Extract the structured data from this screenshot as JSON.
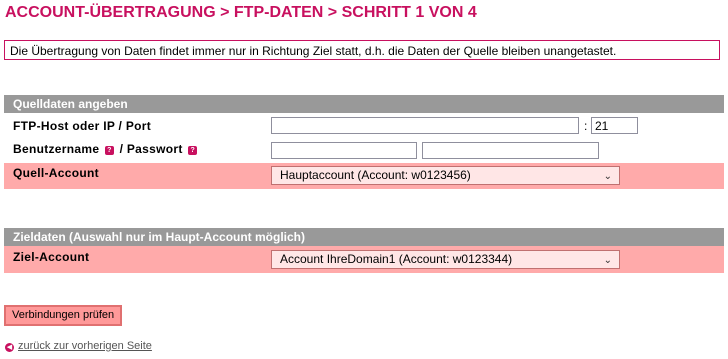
{
  "page": {
    "title": "ACCOUNT-ÜBERTRAGUNG > FTP-DATEN > SCHRITT 1 VON 4",
    "notice": "Die Übertragung von Daten findet immer nur in Richtung Ziel statt, d.h. die Daten der Quelle bleiben unangetastet."
  },
  "source": {
    "header": "Quelldaten angeben",
    "host_label": "FTP-Host oder IP / Port",
    "host_value": "",
    "port_separator": ":",
    "port_value": "21",
    "user_label": "Benutzername",
    "pass_label": "Passwort",
    "label_separator": "/",
    "info_glyph": "?",
    "user_value": "",
    "pass_value": "",
    "account_label": "Quell-Account",
    "account_selected": "Hauptaccount   (Account: w0123456)"
  },
  "target": {
    "header": "Zieldaten (Auswahl nur im Haupt-Account möglich)",
    "account_label": "Ziel-Account",
    "account_selected": "Account IhreDomain1   (Account: w0123344)"
  },
  "actions": {
    "check_button": "Verbindungen prüfen",
    "back_link": "zurück zur vorherigen Seite"
  },
  "icons": {
    "select_chevron": "chevron-down-icon",
    "info": "info-icon",
    "back": "back-arrow-icon"
  },
  "colors": {
    "brand": "#c8105f",
    "section_header": "#999999",
    "highlight_row": "#ffaaaa"
  }
}
